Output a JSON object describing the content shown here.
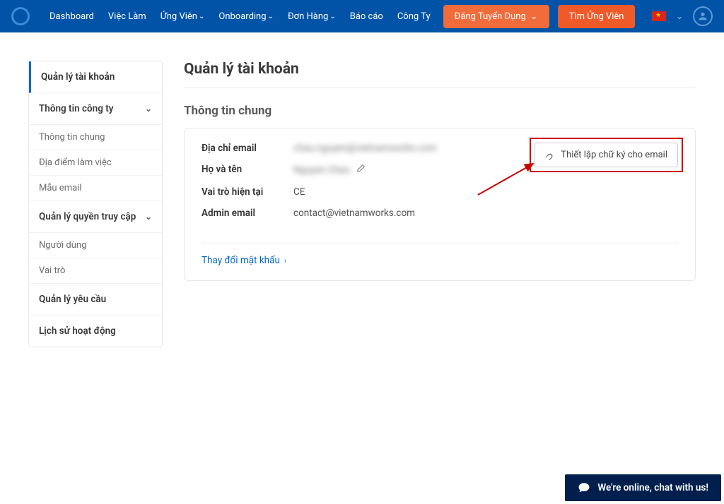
{
  "nav": {
    "items": [
      "Dashboard",
      "Việc Làm",
      "Ứng Viên",
      "Onboarding",
      "Đơn Hàng",
      "Báo cáo",
      "Công Ty"
    ],
    "dropdowns": [
      false,
      false,
      true,
      true,
      true,
      false,
      false
    ],
    "post_job": "Đăng Tuyển Dụng",
    "find_candidates": "Tìm Ứng Viên"
  },
  "sidebar": {
    "account_mgmt": "Quản lý tài khoản",
    "company_info": "Thông tin công ty",
    "subs": {
      "general": "Thông tin chung",
      "locations": "Địa điểm làm việc",
      "email_tpl": "Mẫu email",
      "users": "Người dùng",
      "roles": "Vai trò"
    },
    "access_mgmt": "Quản lý quyền truy cập",
    "request_mgmt": "Quản lý yêu cầu",
    "activity_log": "Lịch sử hoạt động"
  },
  "page": {
    "title": "Quản lý tài khoản",
    "section": "Thông tin chung",
    "email_label": "Địa chỉ email",
    "email_value": "chau.nguyen@vietnamworks.com",
    "name_label": "Họ và tên",
    "name_value": "Nguyen Chau",
    "role_label": "Vai trò hiện tại",
    "role_value": "CE",
    "admin_label": "Admin email",
    "admin_value": "contact@vietnamworks.com",
    "signature_btn": "Thiết lập chữ ký cho email",
    "change_pwd": "Thay đổi mật khẩu"
  },
  "chat": "We're online, chat with us!"
}
